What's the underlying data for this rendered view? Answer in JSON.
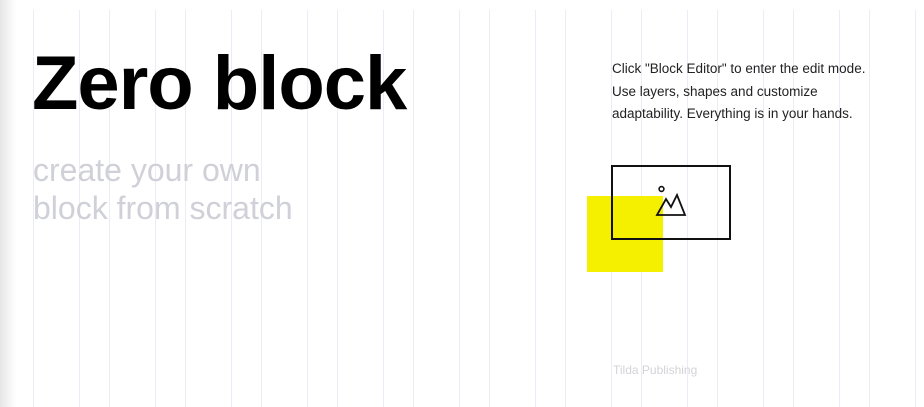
{
  "block": {
    "title": "Zero block",
    "subtitle_line1": "create your own",
    "subtitle_line2": "block from scratch",
    "description_line1": "Click \"Block Editor\" to enter the edit mode.",
    "description_line2": "Use layers, shapes and customize",
    "description_line3": "adaptability. Everything is in your hands.",
    "footer": "Tilda Publishing"
  },
  "icons": {
    "image_placeholder": "image-placeholder-icon"
  },
  "colors": {
    "accent_yellow": "#f5f000",
    "title": "#000000",
    "subtitle": "#d0d0d8",
    "grid_line": "#ececf6",
    "footer": "#d3d3d8"
  }
}
